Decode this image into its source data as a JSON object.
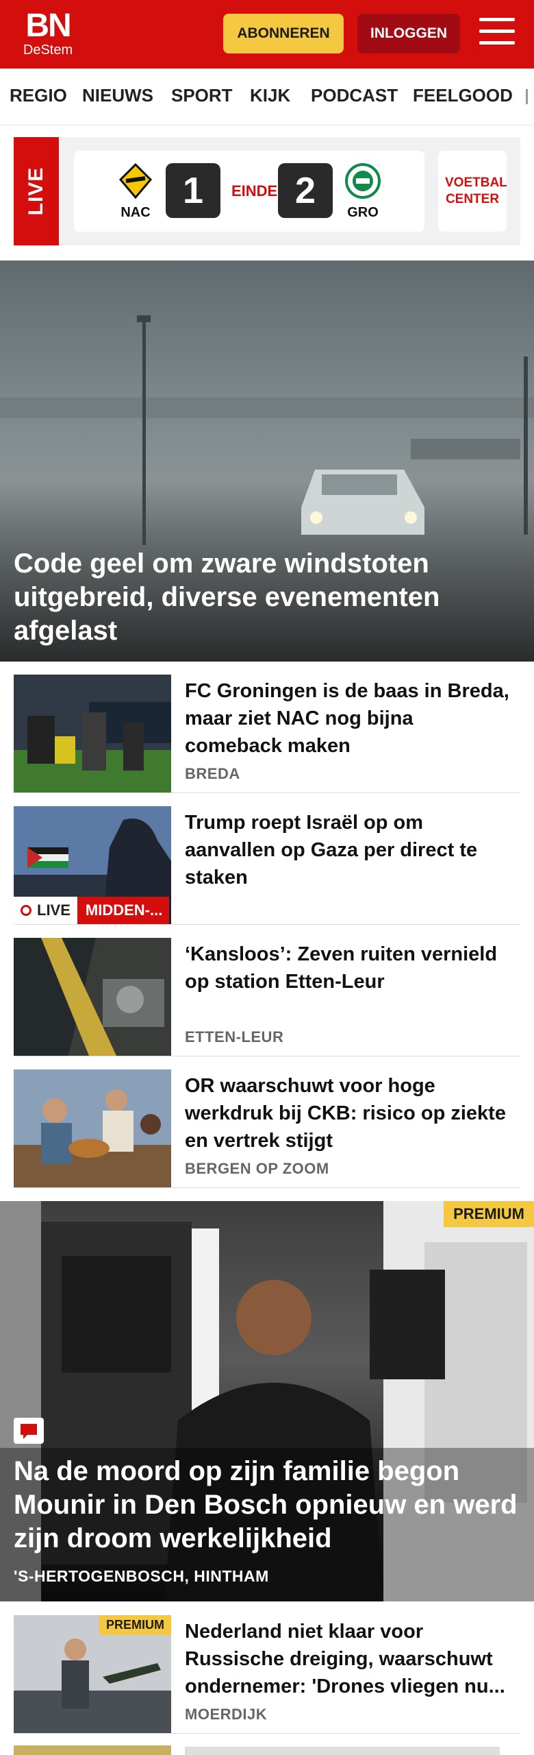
{
  "header": {
    "logo_big": "BN",
    "logo_small": "DeStem",
    "subscribe_label": "ABONNEREN",
    "login_label": "INLOGGEN"
  },
  "nav": {
    "items": [
      "REGIO",
      "NIEUWS",
      "SPORT",
      "KIJK",
      "PODCAST",
      "FEELGOOD"
    ]
  },
  "live": {
    "tag": "LIVE",
    "home_team": "NAC",
    "away_team": "GRO",
    "home_score": "1",
    "away_score": "2",
    "status": "EINDE",
    "voetbal_center": "VOETBAL CENTER"
  },
  "hero": {
    "title": "Code geel om zware windstoten uitgebreid, diverse evenementen afgelast"
  },
  "articles": [
    {
      "title": "FC Groningen is de baas in Breda, maar ziet NAC nog bijna comeback maken",
      "location": "BREDA"
    },
    {
      "title": "Trump roept Israël op om aanvallen op Gaza per direct te staken",
      "location": "",
      "live_label": "LIVE",
      "topic": "MIDDEN-..."
    },
    {
      "title": "‘Kansloos’: Zeven ruiten vernield op station Etten-Leur",
      "location": "ETTEN-LEUR"
    },
    {
      "title": "OR waarschuwt voor hoge werkdruk bij CKB: risico op ziekte en vertrek stijgt",
      "location": "BERGEN OP ZOOM"
    }
  ],
  "feature": {
    "badge": "PREMIUM",
    "title": "Na de moord op zijn familie begon Mounir in Den Bosch opnieuw en werd zijn droom werkelijkheid",
    "location": "'S-HERTOGENBOSCH, HINTHAM"
  },
  "article_bottom": {
    "badge": "PREMIUM",
    "title": "Nederland niet klaar voor Russische dreiging, waarschuwt ondernemer: 'Drones vliegen nu...",
    "location": "MOERDIJK"
  },
  "colors": {
    "brand_red": "#d40d0d",
    "premium_yellow": "#f5c842",
    "login_dark": "#a30b14"
  }
}
